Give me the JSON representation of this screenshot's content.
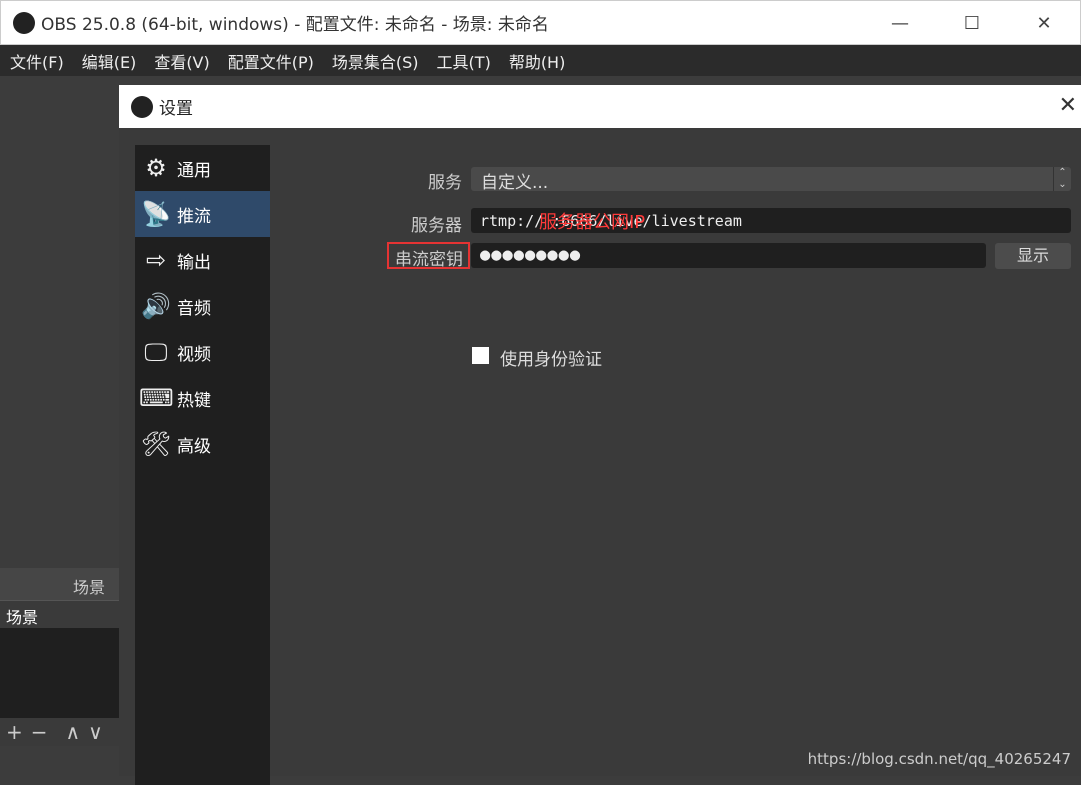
{
  "window": {
    "title": "OBS 25.0.8 (64-bit, windows) - 配置文件: 未命名 - 场景: 未命名",
    "minimize": "—",
    "maximize": "☐",
    "close": "✕"
  },
  "menu": [
    "文件(F)",
    "编辑(E)",
    "查看(V)",
    "配置文件(P)",
    "场景集合(S)",
    "工具(T)",
    "帮助(H)"
  ],
  "scenes": {
    "header": "场景",
    "items": [
      "场景"
    ],
    "tools": [
      "+",
      "−",
      "∧",
      "∨"
    ]
  },
  "settings": {
    "title": "设置",
    "close": "✕",
    "nav": [
      {
        "label": "通用",
        "icon": "gear-icon",
        "glyph": "⚙"
      },
      {
        "label": "推流",
        "icon": "antenna-icon",
        "glyph": "📡"
      },
      {
        "label": "输出",
        "icon": "output-monitor-icon",
        "glyph": "⇨"
      },
      {
        "label": "音频",
        "icon": "speaker-icon",
        "glyph": "🔊"
      },
      {
        "label": "视频",
        "icon": "monitor-icon",
        "glyph": "🖵"
      },
      {
        "label": "热键",
        "icon": "keyboard-icon",
        "glyph": "⌨"
      },
      {
        "label": "高级",
        "icon": "tools-icon",
        "glyph": "🛠"
      }
    ],
    "active_nav": 1,
    "service_label": "服务",
    "service_value": "自定义...",
    "server_label": "服务器",
    "server_value": "rtmp://            :6666/live/livestream",
    "server_annotation": "服务器公网IP",
    "key_label": "串流密钥",
    "key_value": "●●●●●●●●●",
    "show_button": "显示",
    "auth_label": "使用身份验证",
    "auth_checked": false
  },
  "watermark": "https://blog.csdn.net/qq_40265247",
  "colors": {
    "annotation": "#e53333",
    "active_nav": "#2f4a6a"
  }
}
